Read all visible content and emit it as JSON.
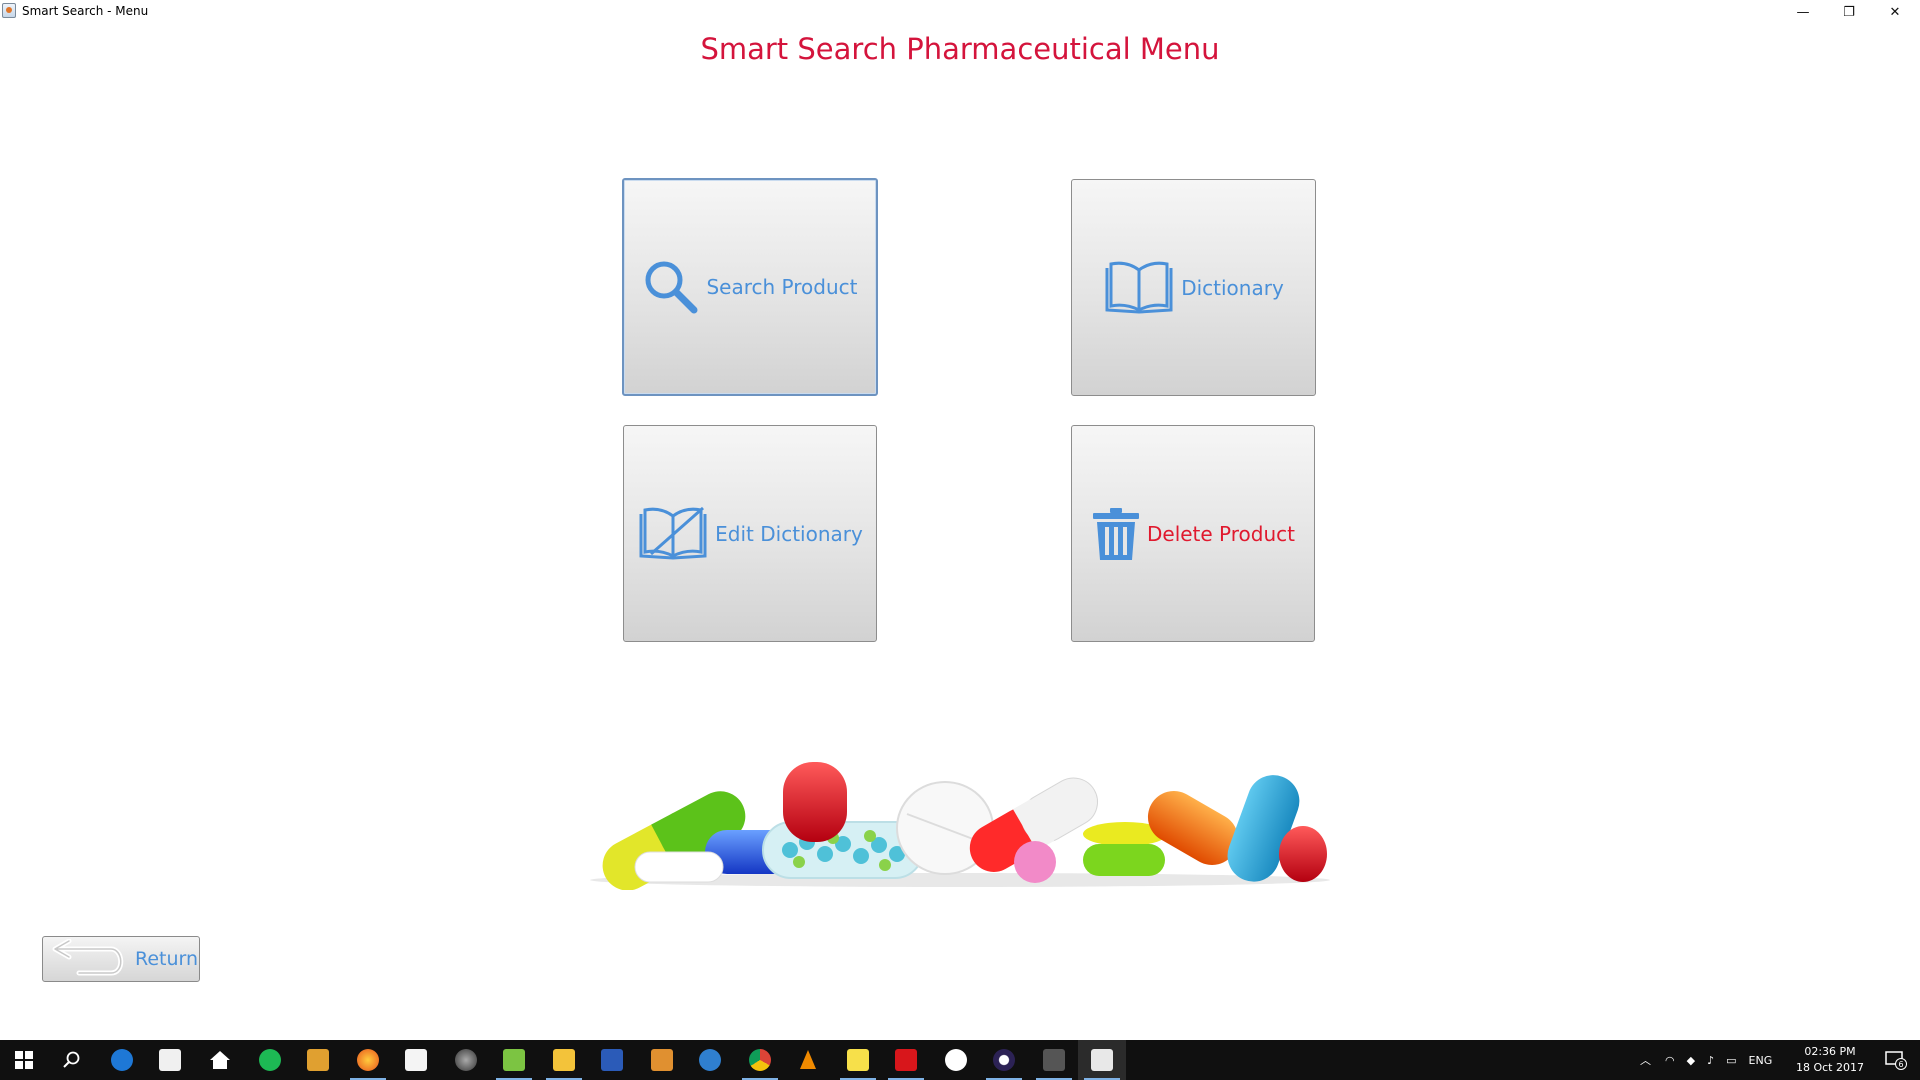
{
  "window": {
    "title": "Smart Search - Menu",
    "controls": {
      "minimize": "—",
      "maximize": "❐",
      "close": "✕"
    }
  },
  "heading": "Smart Search Pharmaceutical Menu",
  "menu": {
    "search": {
      "label": "Search Product",
      "icon": "search-icon"
    },
    "dictionary": {
      "label": "Dictionary",
      "icon": "book-icon"
    },
    "edit_dictionary": {
      "label": "Edit Dictionary",
      "icon": "edit-book-icon"
    },
    "delete": {
      "label": "Delete Product",
      "icon": "trash-icon"
    }
  },
  "return_button": {
    "label": "Return",
    "icon": "return-arrow-icon"
  },
  "taskbar": {
    "apps": [
      "start-icon",
      "search-icon",
      "edge-icon",
      "store-icon",
      "home-icon",
      "spotify-icon",
      "archive-icon",
      "firefox-icon",
      "file-print-icon",
      "photo-icon",
      "notepad-icon",
      "file-explorer-icon",
      "word-icon",
      "media-player-icon",
      "mail-icon",
      "chrome-icon",
      "vlc-icon",
      "sticky-notes-icon",
      "acrobat-icon",
      "slack-icon",
      "eclipse-icon",
      "app-icon",
      "java-icon"
    ],
    "tray": {
      "language": "ENG",
      "time": "02:36 PM",
      "date": "18 Oct 2017",
      "notifications": "6"
    }
  },
  "colors": {
    "heading": "#d4143c",
    "accent_blue": "#4a90d9",
    "delete_red": "#e0192e",
    "taskbar": "#101010"
  }
}
